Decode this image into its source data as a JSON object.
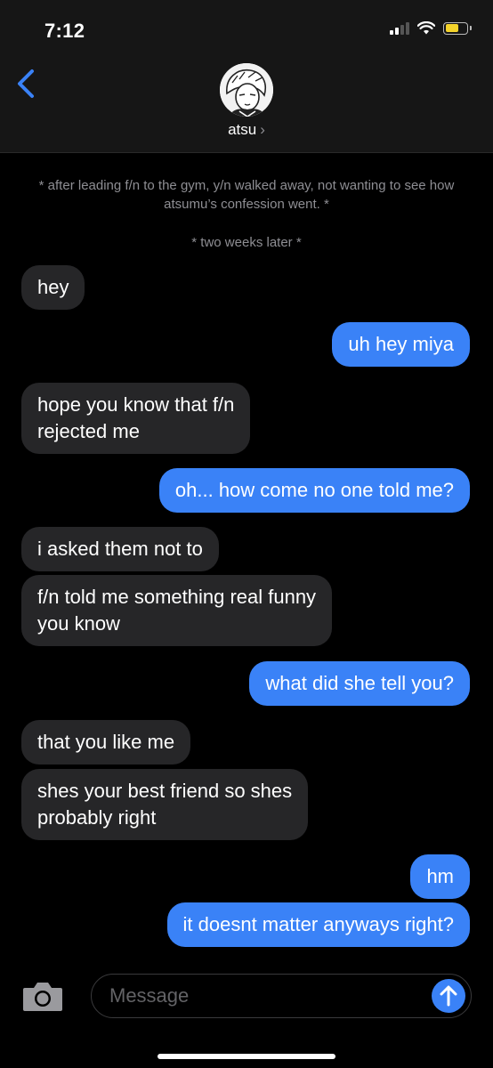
{
  "status_bar": {
    "time": "7:12"
  },
  "header": {
    "contact_name": "atsu",
    "chevron": "›"
  },
  "narration": [
    "* after leading f/n to the gym, y/n walked away, not wanting to see how atsumu’s confession went. *",
    "* two weeks later *"
  ],
  "messages": [
    {
      "from": "them",
      "text": "hey"
    },
    {
      "from": "me",
      "text": "uh hey miya"
    },
    {
      "from": "them",
      "text": "hope you know that f/n\nrejected me"
    },
    {
      "from": "me",
      "text": "oh... how come no one told me?"
    },
    {
      "from": "them",
      "text": "i asked them not to"
    },
    {
      "from": "them",
      "text": "f/n told me something real funny\nyou know"
    },
    {
      "from": "me",
      "text": "what did she tell you?"
    },
    {
      "from": "them",
      "text": "that you like me"
    },
    {
      "from": "them",
      "text": "shes your best friend so shes\nprobably right"
    },
    {
      "from": "me",
      "text": "hm"
    },
    {
      "from": "me",
      "text": "it doesnt matter anyways right?"
    }
  ],
  "input": {
    "placeholder": "Message"
  },
  "icons": {
    "back": "chevron-left-icon",
    "camera": "camera-icon",
    "send": "arrow-up-icon"
  },
  "colors": {
    "incoming": "#262628",
    "outgoing": "#3a82f7",
    "background": "#000000"
  }
}
